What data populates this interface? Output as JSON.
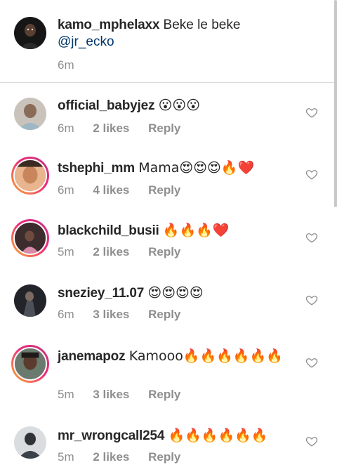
{
  "caption": {
    "username": "kamo_mphelaxx",
    "text": "Beke le beke",
    "mention": "@jr_ecko",
    "time": "6m"
  },
  "reply_label": "Reply",
  "comments": [
    {
      "username": "official_babyjez",
      "text": "😮😮😮",
      "time": "6m",
      "likes": "2 likes",
      "avatar_color": "#b9a89a"
    },
    {
      "username": "tshephi_mm",
      "text": "Mama😍😍😍🔥❤️",
      "time": "6m",
      "likes": "4 likes",
      "avatar_color": "#d9a07a"
    },
    {
      "username": "blackchild_busii",
      "text": "🔥🔥🔥❤️",
      "time": "5m",
      "likes": "2 likes",
      "avatar_color": "#6b4a4a"
    },
    {
      "username": "sneziey_11.07",
      "text": "😍😍😍😍",
      "time": "6m",
      "likes": "3 likes",
      "avatar_color": "#2b2d33"
    },
    {
      "username": "janemapoz",
      "text": "Kamooo🔥🔥🔥🔥🔥🔥",
      "time": "5m",
      "likes": "3 likes",
      "avatar_color": "#3a2e2a"
    },
    {
      "username": "mr_wrongcall254",
      "text": "🔥🔥🔥🔥🔥🔥",
      "time": "5m",
      "likes": "2 likes",
      "avatar_color": "#4a5560"
    }
  ]
}
